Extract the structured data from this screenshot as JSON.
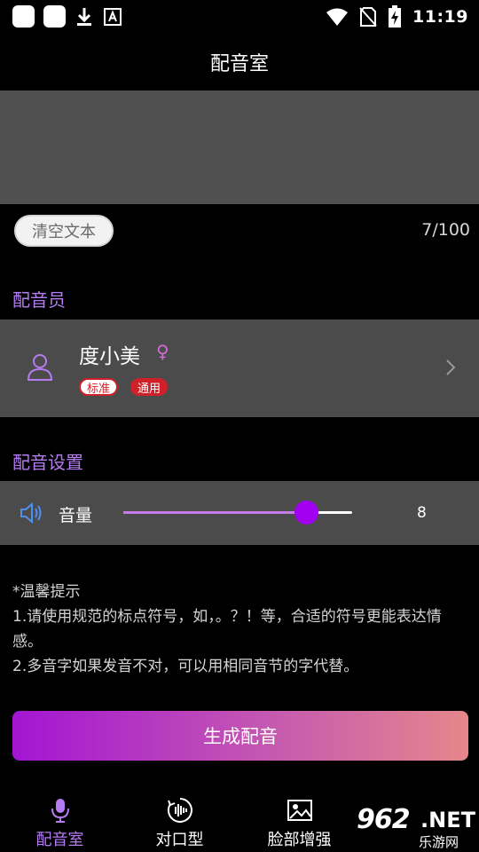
{
  "status_bar": {
    "time": "11:19"
  },
  "header": {
    "title": "配音室"
  },
  "editor": {
    "text": "",
    "clear_label": "清空文本",
    "counter": "7/100"
  },
  "voice_section": {
    "title": "配音员",
    "name": "度小美",
    "gender_symbol": "♀",
    "tags": [
      "标准",
      "通用"
    ]
  },
  "settings_section": {
    "title": "配音设置",
    "volume_label": "音量",
    "volume_value": "8",
    "volume_fraction": 0.8
  },
  "tips": {
    "title": "*温馨提示",
    "line1": "1.请使用规范的标点符号，如，。？！等，合适的符号更能表达情感。",
    "line2": "2.多音字如果发音不对，可以用相同音节的字代替。"
  },
  "generate_button": {
    "label": "生成配音"
  },
  "bottom_nav": {
    "items": [
      {
        "label": "配音室",
        "icon": "microphone-icon",
        "active": true
      },
      {
        "label": "对口型",
        "icon": "lip-sync-icon",
        "active": false
      },
      {
        "label": "脸部增强",
        "icon": "face-enhance-icon",
        "active": false
      }
    ]
  },
  "watermark": {
    "number": "962",
    "suffix": ".NET",
    "sub": "乐游网"
  },
  "colors": {
    "accent": "#b57cf2",
    "slider_thumb": "#a100f0",
    "tag_red": "#d0202a"
  }
}
